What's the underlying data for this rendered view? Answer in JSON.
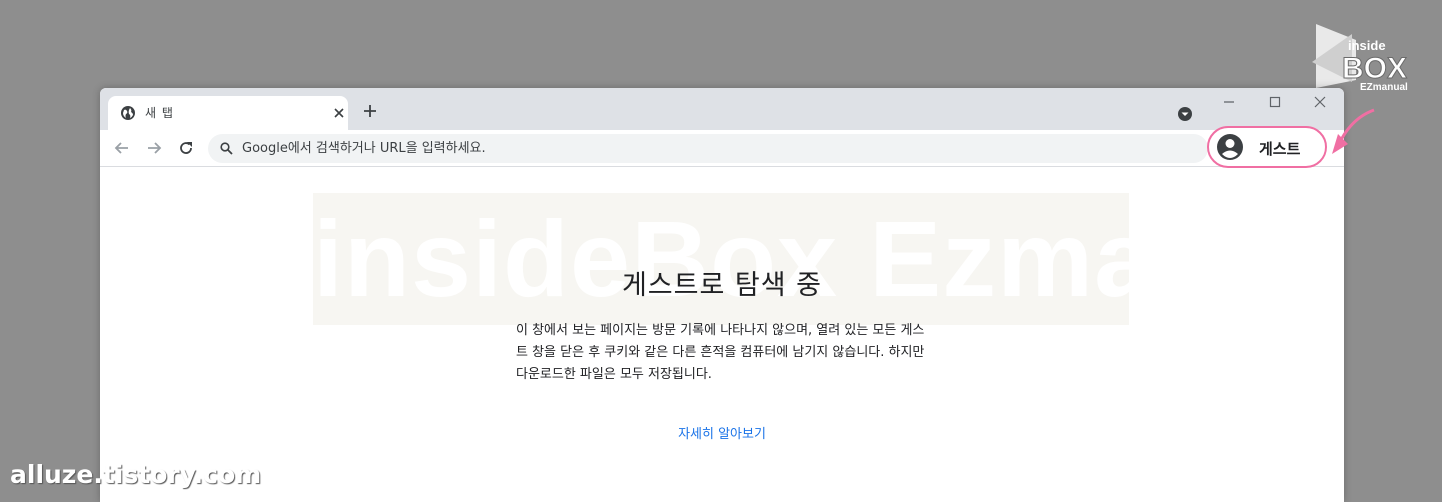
{
  "tab": {
    "title": "새 탭"
  },
  "omnibox": {
    "placeholder": "Google에서 검색하거나 URL을 입력하세요."
  },
  "profile": {
    "label": "게스트"
  },
  "content": {
    "watermark": "insideBox Ezmanual",
    "title": "게스트로 탐색 중",
    "description": "이 창에서 보는 페이지는 방문 기록에 나타나지 않으며, 열려 있는 모든 게스트 창을 닫은 후 쿠키와 같은 다른 흔적을 컴퓨터에 남기지 않습니다. 하지만 다운로드한 파일은 모두 저장됩니다.",
    "learn_more": "자세히 알아보기"
  },
  "site": {
    "logo_top": "inside",
    "logo_main": "BOX",
    "logo_sub": "EZmanual",
    "url": "alluze.tistory.com"
  },
  "colors": {
    "accent_pink": "#f06fa3",
    "link_blue": "#1a73e8",
    "tabstrip_bg": "#dee1e6",
    "omnibox_bg": "#f1f3f4"
  },
  "icons": {
    "favicon": "globe-icon",
    "tab_close": "close-icon",
    "new_tab": "plus-icon",
    "tab_search": "dropdown-circle-icon",
    "back": "arrow-left-icon",
    "forward": "arrow-right-icon",
    "reload": "reload-icon",
    "search": "search-icon",
    "profile": "account-circle-icon",
    "minimize": "minimize-icon",
    "maximize": "maximize-icon",
    "close": "window-close-icon"
  }
}
